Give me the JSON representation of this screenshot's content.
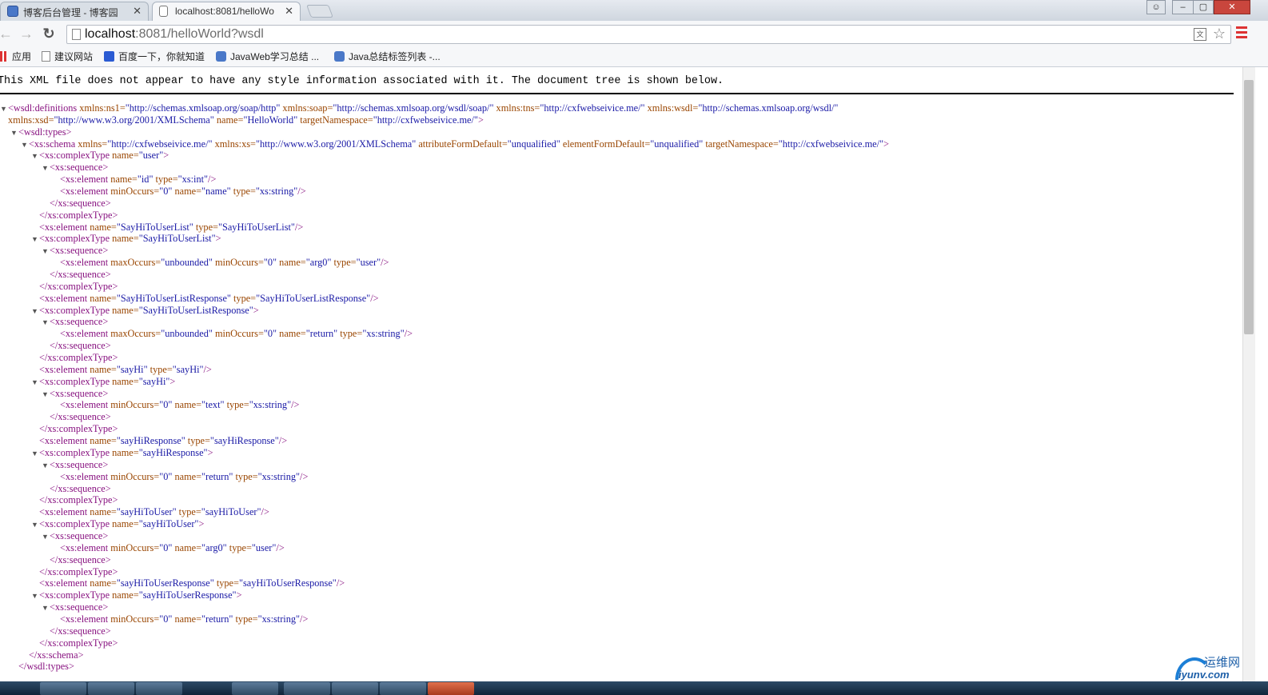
{
  "browser": {
    "tabs": [
      {
        "title": "博客后台管理 - 博客园"
      },
      {
        "title": "localhost:8081/helloWo"
      }
    ],
    "url_host": "localhost",
    "url_rest": ":8081/helloWorld?wsdl"
  },
  "bookmarks": [
    {
      "label": "应用"
    },
    {
      "label": "建议网站"
    },
    {
      "label": "百度一下，你就知道"
    },
    {
      "label": "JavaWeb学习总结 ..."
    },
    {
      "label": "Java总结标签列表 -..."
    }
  ],
  "page": {
    "notice": "This XML file does not appear to have any style information associated with it. The document tree is shown below."
  },
  "xml_lines": [
    {
      "i": 0,
      "t": "▼",
      "h": [
        [
          "t",
          "<wsdl:definitions"
        ],
        [
          "n",
          " xmlns:ns1="
        ],
        [
          "v",
          "\"http://schemas.xmlsoap.org/soap/http\""
        ],
        [
          "n",
          " xmlns:soap="
        ],
        [
          "v",
          "\"http://schemas.xmlsoap.org/wsdl/soap/\""
        ],
        [
          "n",
          " xmlns:tns="
        ],
        [
          "v",
          "\"http://cxfwebseivice.me/\""
        ],
        [
          "n",
          " xmlns:wsdl="
        ],
        [
          "v",
          "\"http://schemas.xmlsoap.org/wsdl/\""
        ]
      ]
    },
    {
      "i": 0,
      "t": "",
      "h": [
        [
          "n",
          "xmlns:xsd="
        ],
        [
          "v",
          "\"http://www.w3.org/2001/XMLSchema\""
        ],
        [
          "n",
          " name="
        ],
        [
          "v",
          "\"HelloWorld\""
        ],
        [
          "n",
          " targetNamespace="
        ],
        [
          "v",
          "\"http://cxfwebseivice.me/\""
        ],
        [
          "t",
          ">"
        ]
      ]
    },
    {
      "i": 1,
      "t": "▼",
      "h": [
        [
          "t",
          "<wsdl:types>"
        ]
      ]
    },
    {
      "i": 2,
      "t": "▼",
      "h": [
        [
          "t",
          "<xs:schema"
        ],
        [
          "n",
          " xmlns="
        ],
        [
          "v",
          "\"http://cxfwebseivice.me/\""
        ],
        [
          "n",
          " xmlns:xs="
        ],
        [
          "v",
          "\"http://www.w3.org/2001/XMLSchema\""
        ],
        [
          "n",
          " attributeFormDefault="
        ],
        [
          "v",
          "\"unqualified\""
        ],
        [
          "n",
          " elementFormDefault="
        ],
        [
          "v",
          "\"unqualified\""
        ],
        [
          "n",
          " targetNamespace="
        ],
        [
          "v",
          "\"http://cxfwebseivice.me/\""
        ],
        [
          "t",
          ">"
        ]
      ]
    },
    {
      "i": 3,
      "t": "▼",
      "h": [
        [
          "t",
          "<xs:complexType"
        ],
        [
          "n",
          " name="
        ],
        [
          "v",
          "\"user\""
        ],
        [
          "t",
          ">"
        ]
      ]
    },
    {
      "i": 4,
      "t": "▼",
      "h": [
        [
          "t",
          "<xs:sequence>"
        ]
      ]
    },
    {
      "i": 5,
      "t": "",
      "h": [
        [
          "t",
          "<xs:element"
        ],
        [
          "n",
          " name="
        ],
        [
          "v",
          "\"id\""
        ],
        [
          "n",
          " type="
        ],
        [
          "v",
          "\"xs:int\""
        ],
        [
          "t",
          "/>"
        ]
      ]
    },
    {
      "i": 5,
      "t": "",
      "h": [
        [
          "t",
          "<xs:element"
        ],
        [
          "n",
          " minOccurs="
        ],
        [
          "v",
          "\"0\""
        ],
        [
          "n",
          " name="
        ],
        [
          "v",
          "\"name\""
        ],
        [
          "n",
          " type="
        ],
        [
          "v",
          "\"xs:string\""
        ],
        [
          "t",
          "/>"
        ]
      ]
    },
    {
      "i": 4,
      "t": "",
      "h": [
        [
          "t",
          "</xs:sequence>"
        ]
      ]
    },
    {
      "i": 3,
      "t": "",
      "h": [
        [
          "t",
          "</xs:complexType>"
        ]
      ]
    },
    {
      "i": 3,
      "t": "",
      "h": [
        [
          "t",
          "<xs:element"
        ],
        [
          "n",
          " name="
        ],
        [
          "v",
          "\"SayHiToUserList\""
        ],
        [
          "n",
          " type="
        ],
        [
          "v",
          "\"SayHiToUserList\""
        ],
        [
          "t",
          "/>"
        ]
      ]
    },
    {
      "i": 3,
      "t": "▼",
      "h": [
        [
          "t",
          "<xs:complexType"
        ],
        [
          "n",
          " name="
        ],
        [
          "v",
          "\"SayHiToUserList\""
        ],
        [
          "t",
          ">"
        ]
      ]
    },
    {
      "i": 4,
      "t": "▼",
      "h": [
        [
          "t",
          "<xs:sequence>"
        ]
      ]
    },
    {
      "i": 5,
      "t": "",
      "h": [
        [
          "t",
          "<xs:element"
        ],
        [
          "n",
          " maxOccurs="
        ],
        [
          "v",
          "\"unbounded\""
        ],
        [
          "n",
          " minOccurs="
        ],
        [
          "v",
          "\"0\""
        ],
        [
          "n",
          " name="
        ],
        [
          "v",
          "\"arg0\""
        ],
        [
          "n",
          " type="
        ],
        [
          "v",
          "\"user\""
        ],
        [
          "t",
          "/>"
        ]
      ]
    },
    {
      "i": 4,
      "t": "",
      "h": [
        [
          "t",
          "</xs:sequence>"
        ]
      ]
    },
    {
      "i": 3,
      "t": "",
      "h": [
        [
          "t",
          "</xs:complexType>"
        ]
      ]
    },
    {
      "i": 3,
      "t": "",
      "h": [
        [
          "t",
          "<xs:element"
        ],
        [
          "n",
          " name="
        ],
        [
          "v",
          "\"SayHiToUserListResponse\""
        ],
        [
          "n",
          " type="
        ],
        [
          "v",
          "\"SayHiToUserListResponse\""
        ],
        [
          "t",
          "/>"
        ]
      ]
    },
    {
      "i": 3,
      "t": "▼",
      "h": [
        [
          "t",
          "<xs:complexType"
        ],
        [
          "n",
          " name="
        ],
        [
          "v",
          "\"SayHiToUserListResponse\""
        ],
        [
          "t",
          ">"
        ]
      ]
    },
    {
      "i": 4,
      "t": "▼",
      "h": [
        [
          "t",
          "<xs:sequence>"
        ]
      ]
    },
    {
      "i": 5,
      "t": "",
      "h": [
        [
          "t",
          "<xs:element"
        ],
        [
          "n",
          " maxOccurs="
        ],
        [
          "v",
          "\"unbounded\""
        ],
        [
          "n",
          " minOccurs="
        ],
        [
          "v",
          "\"0\""
        ],
        [
          "n",
          " name="
        ],
        [
          "v",
          "\"return\""
        ],
        [
          "n",
          " type="
        ],
        [
          "v",
          "\"xs:string\""
        ],
        [
          "t",
          "/>"
        ]
      ]
    },
    {
      "i": 4,
      "t": "",
      "h": [
        [
          "t",
          "</xs:sequence>"
        ]
      ]
    },
    {
      "i": 3,
      "t": "",
      "h": [
        [
          "t",
          "</xs:complexType>"
        ]
      ]
    },
    {
      "i": 3,
      "t": "",
      "h": [
        [
          "t",
          "<xs:element"
        ],
        [
          "n",
          " name="
        ],
        [
          "v",
          "\"sayHi\""
        ],
        [
          "n",
          " type="
        ],
        [
          "v",
          "\"sayHi\""
        ],
        [
          "t",
          "/>"
        ]
      ]
    },
    {
      "i": 3,
      "t": "▼",
      "h": [
        [
          "t",
          "<xs:complexType"
        ],
        [
          "n",
          " name="
        ],
        [
          "v",
          "\"sayHi\""
        ],
        [
          "t",
          ">"
        ]
      ]
    },
    {
      "i": 4,
      "t": "▼",
      "h": [
        [
          "t",
          "<xs:sequence>"
        ]
      ]
    },
    {
      "i": 5,
      "t": "",
      "h": [
        [
          "t",
          "<xs:element"
        ],
        [
          "n",
          " minOccurs="
        ],
        [
          "v",
          "\"0\""
        ],
        [
          "n",
          " name="
        ],
        [
          "v",
          "\"text\""
        ],
        [
          "n",
          " type="
        ],
        [
          "v",
          "\"xs:string\""
        ],
        [
          "t",
          "/>"
        ]
      ]
    },
    {
      "i": 4,
      "t": "",
      "h": [
        [
          "t",
          "</xs:sequence>"
        ]
      ]
    },
    {
      "i": 3,
      "t": "",
      "h": [
        [
          "t",
          "</xs:complexType>"
        ]
      ]
    },
    {
      "i": 3,
      "t": "",
      "h": [
        [
          "t",
          "<xs:element"
        ],
        [
          "n",
          " name="
        ],
        [
          "v",
          "\"sayHiResponse\""
        ],
        [
          "n",
          " type="
        ],
        [
          "v",
          "\"sayHiResponse\""
        ],
        [
          "t",
          "/>"
        ]
      ]
    },
    {
      "i": 3,
      "t": "▼",
      "h": [
        [
          "t",
          "<xs:complexType"
        ],
        [
          "n",
          " name="
        ],
        [
          "v",
          "\"sayHiResponse\""
        ],
        [
          "t",
          ">"
        ]
      ]
    },
    {
      "i": 4,
      "t": "▼",
      "h": [
        [
          "t",
          "<xs:sequence>"
        ]
      ]
    },
    {
      "i": 5,
      "t": "",
      "h": [
        [
          "t",
          "<xs:element"
        ],
        [
          "n",
          " minOccurs="
        ],
        [
          "v",
          "\"0\""
        ],
        [
          "n",
          " name="
        ],
        [
          "v",
          "\"return\""
        ],
        [
          "n",
          " type="
        ],
        [
          "v",
          "\"xs:string\""
        ],
        [
          "t",
          "/>"
        ]
      ]
    },
    {
      "i": 4,
      "t": "",
      "h": [
        [
          "t",
          "</xs:sequence>"
        ]
      ]
    },
    {
      "i": 3,
      "t": "",
      "h": [
        [
          "t",
          "</xs:complexType>"
        ]
      ]
    },
    {
      "i": 3,
      "t": "",
      "h": [
        [
          "t",
          "<xs:element"
        ],
        [
          "n",
          " name="
        ],
        [
          "v",
          "\"sayHiToUser\""
        ],
        [
          "n",
          " type="
        ],
        [
          "v",
          "\"sayHiToUser\""
        ],
        [
          "t",
          "/>"
        ]
      ]
    },
    {
      "i": 3,
      "t": "▼",
      "h": [
        [
          "t",
          "<xs:complexType"
        ],
        [
          "n",
          " name="
        ],
        [
          "v",
          "\"sayHiToUser\""
        ],
        [
          "t",
          ">"
        ]
      ]
    },
    {
      "i": 4,
      "t": "▼",
      "h": [
        [
          "t",
          "<xs:sequence>"
        ]
      ]
    },
    {
      "i": 5,
      "t": "",
      "h": [
        [
          "t",
          "<xs:element"
        ],
        [
          "n",
          " minOccurs="
        ],
        [
          "v",
          "\"0\""
        ],
        [
          "n",
          " name="
        ],
        [
          "v",
          "\"arg0\""
        ],
        [
          "n",
          " type="
        ],
        [
          "v",
          "\"user\""
        ],
        [
          "t",
          "/>"
        ]
      ]
    },
    {
      "i": 4,
      "t": "",
      "h": [
        [
          "t",
          "</xs:sequence>"
        ]
      ]
    },
    {
      "i": 3,
      "t": "",
      "h": [
        [
          "t",
          "</xs:complexType>"
        ]
      ]
    },
    {
      "i": 3,
      "t": "",
      "h": [
        [
          "t",
          "<xs:element"
        ],
        [
          "n",
          " name="
        ],
        [
          "v",
          "\"sayHiToUserResponse\""
        ],
        [
          "n",
          " type="
        ],
        [
          "v",
          "\"sayHiToUserResponse\""
        ],
        [
          "t",
          "/>"
        ]
      ]
    },
    {
      "i": 3,
      "t": "▼",
      "h": [
        [
          "t",
          "<xs:complexType"
        ],
        [
          "n",
          " name="
        ],
        [
          "v",
          "\"sayHiToUserResponse\""
        ],
        [
          "t",
          ">"
        ]
      ]
    },
    {
      "i": 4,
      "t": "▼",
      "h": [
        [
          "t",
          "<xs:sequence>"
        ]
      ]
    },
    {
      "i": 5,
      "t": "",
      "h": [
        [
          "t",
          "<xs:element"
        ],
        [
          "n",
          " minOccurs="
        ],
        [
          "v",
          "\"0\""
        ],
        [
          "n",
          " name="
        ],
        [
          "v",
          "\"return\""
        ],
        [
          "n",
          " type="
        ],
        [
          "v",
          "\"xs:string\""
        ],
        [
          "t",
          "/>"
        ]
      ]
    },
    {
      "i": 4,
      "t": "",
      "h": [
        [
          "t",
          "</xs:sequence>"
        ]
      ]
    },
    {
      "i": 3,
      "t": "",
      "h": [
        [
          "t",
          "</xs:complexType>"
        ]
      ]
    },
    {
      "i": 2,
      "t": "",
      "h": [
        [
          "t",
          "</xs:schema>"
        ]
      ]
    },
    {
      "i": 1,
      "t": "",
      "h": [
        [
          "t",
          "</wsdl:types>"
        ]
      ]
    }
  ],
  "watermark": {
    "text": "运维网",
    "sub": "iyunv.com"
  },
  "colors": {
    "tag": "#881280",
    "attr_name": "#994500",
    "attr_value": "#1a1aa6"
  }
}
